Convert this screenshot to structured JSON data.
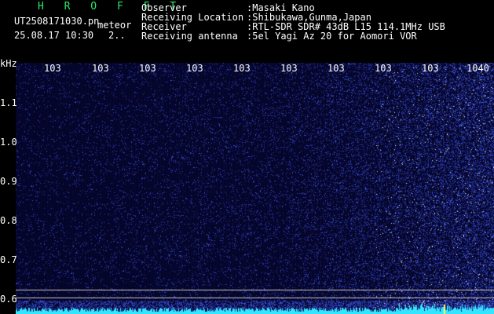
{
  "header": {
    "brand": "H R O F F T",
    "file_name": "UT2508171030.pn",
    "file_suffix": "meteor",
    "timestamp": "25.08.17 10:30",
    "extra_value": "2..",
    "info": [
      {
        "label": "Observer",
        "value": ":Masaki Kano"
      },
      {
        "label": "Receiving Location",
        "value": ":Shibukawa,Gunma,Japan"
      },
      {
        "label": "Receiver",
        "value": ":RTL-SDR SDR# 43dB L15 114.1MHz USB"
      },
      {
        "label": "Receiving antenna",
        "value": ":5el Yagi Az 20 for Aomori VOR"
      }
    ]
  },
  "x_ticks": [
    "103",
    "103",
    "103",
    "103",
    "103",
    "103",
    "103",
    "103",
    "103",
    "1040"
  ],
  "y_axis": {
    "unit": "kHz",
    "labels": [
      "1.1",
      "1.0",
      "0.9",
      "0.8",
      "0.7",
      "0.6"
    ]
  },
  "colors": {
    "background": "#000000",
    "plot_background": "#05052a",
    "brand": "#2ee66b",
    "noise": "#3a55ff",
    "baseline_noise": "#33e6ff",
    "reference_line": "#c8c8c8",
    "marker": "#ffff55"
  }
}
